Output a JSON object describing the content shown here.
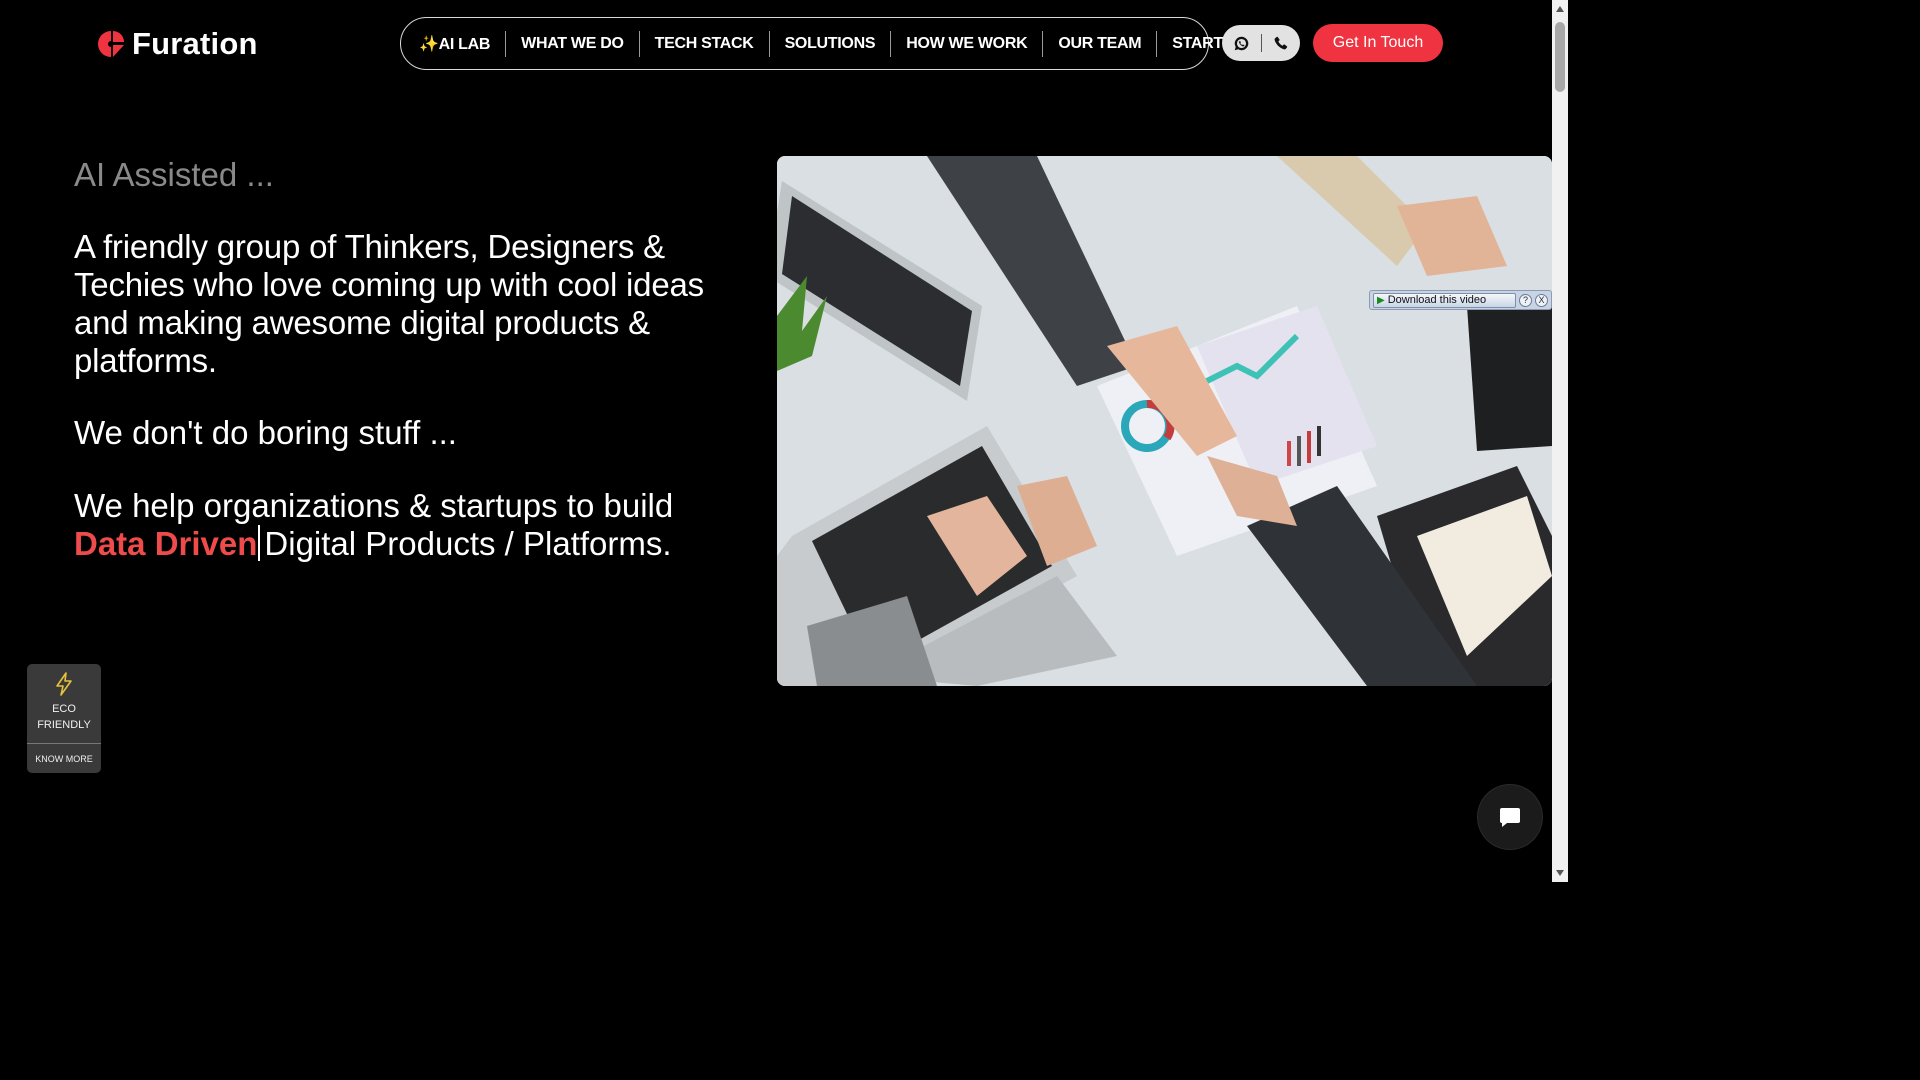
{
  "brand": {
    "name": "Furation",
    "color": "#ef3340"
  },
  "nav": {
    "items": [
      {
        "icon": "sparkles-icon",
        "label": "✨AI LAB"
      },
      {
        "label": "WHAT WE DO"
      },
      {
        "label": "TECH STACK"
      },
      {
        "label": "SOLUTIONS"
      },
      {
        "label": "HOW WE WORK"
      },
      {
        "label": "OUR TEAM"
      },
      {
        "label": "STARTUP"
      }
    ]
  },
  "contact": {
    "whatsapp_icon": "whatsapp-icon",
    "phone_icon": "phone-icon"
  },
  "cta": {
    "label": "Get In Touch"
  },
  "hero": {
    "subtitle": "AI Assisted ...",
    "paragraph": "A friendly group of Thinkers, Designers & Techies who love coming up with cool ideas and making awesome digital products & platforms.",
    "line2": "We don't do boring stuff ...",
    "line3_prefix": "We help organizations & startups to build",
    "line3_accent": "Data Driven",
    "line3_suffix": "Digital Products / Platforms."
  },
  "video_overlay": {
    "download_label": "Download this video",
    "help": "?",
    "close": "X"
  },
  "eco_badge": {
    "label_line1": "ECO",
    "label_line2": "FRIENDLY",
    "more": "KNOW MORE",
    "icon": "lightning-icon"
  },
  "chat": {
    "icon": "chat-icon"
  }
}
